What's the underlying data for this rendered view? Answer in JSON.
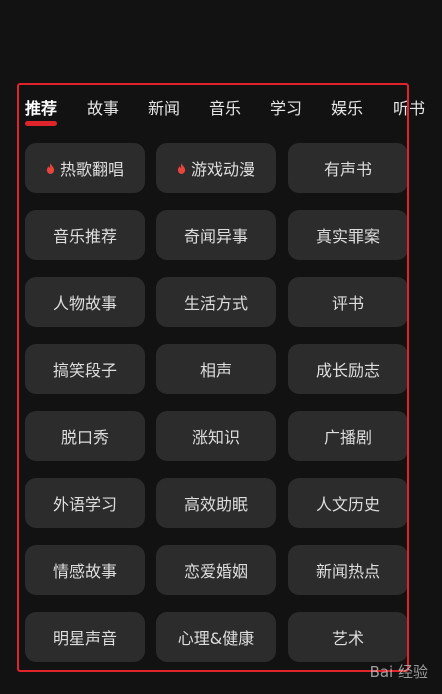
{
  "tabs": [
    {
      "label": "推荐",
      "active": true
    },
    {
      "label": "故事",
      "active": false
    },
    {
      "label": "新闻",
      "active": false
    },
    {
      "label": "音乐",
      "active": false
    },
    {
      "label": "学习",
      "active": false
    },
    {
      "label": "娱乐",
      "active": false
    },
    {
      "label": "听书",
      "active": false
    }
  ],
  "categories": [
    {
      "label": "热歌翻唱",
      "hot": true
    },
    {
      "label": "游戏动漫",
      "hot": true
    },
    {
      "label": "有声书",
      "hot": false
    },
    {
      "label": "音乐推荐",
      "hot": false
    },
    {
      "label": "奇闻异事",
      "hot": false
    },
    {
      "label": "真实罪案",
      "hot": false
    },
    {
      "label": "人物故事",
      "hot": false
    },
    {
      "label": "生活方式",
      "hot": false
    },
    {
      "label": "评书",
      "hot": false
    },
    {
      "label": "搞笑段子",
      "hot": false
    },
    {
      "label": "相声",
      "hot": false
    },
    {
      "label": "成长励志",
      "hot": false
    },
    {
      "label": "脱口秀",
      "hot": false
    },
    {
      "label": "涨知识",
      "hot": false
    },
    {
      "label": "广播剧",
      "hot": false
    },
    {
      "label": "外语学习",
      "hot": false
    },
    {
      "label": "高效助眠",
      "hot": false
    },
    {
      "label": "人文历史",
      "hot": false
    },
    {
      "label": "情感故事",
      "hot": false
    },
    {
      "label": "恋爱婚姻",
      "hot": false
    },
    {
      "label": "新闻热点",
      "hot": false
    },
    {
      "label": "明星声音",
      "hot": false
    },
    {
      "label": "心理&健康",
      "hot": false
    },
    {
      "label": "艺术",
      "hot": false
    }
  ],
  "watermark": {
    "text": "Bai 经验"
  },
  "colors": {
    "background": "#121212",
    "chip": "#2c2c2c",
    "accent": "#e0242b",
    "flame": "#e8453c"
  },
  "icons": {
    "hot": "flame-icon"
  }
}
